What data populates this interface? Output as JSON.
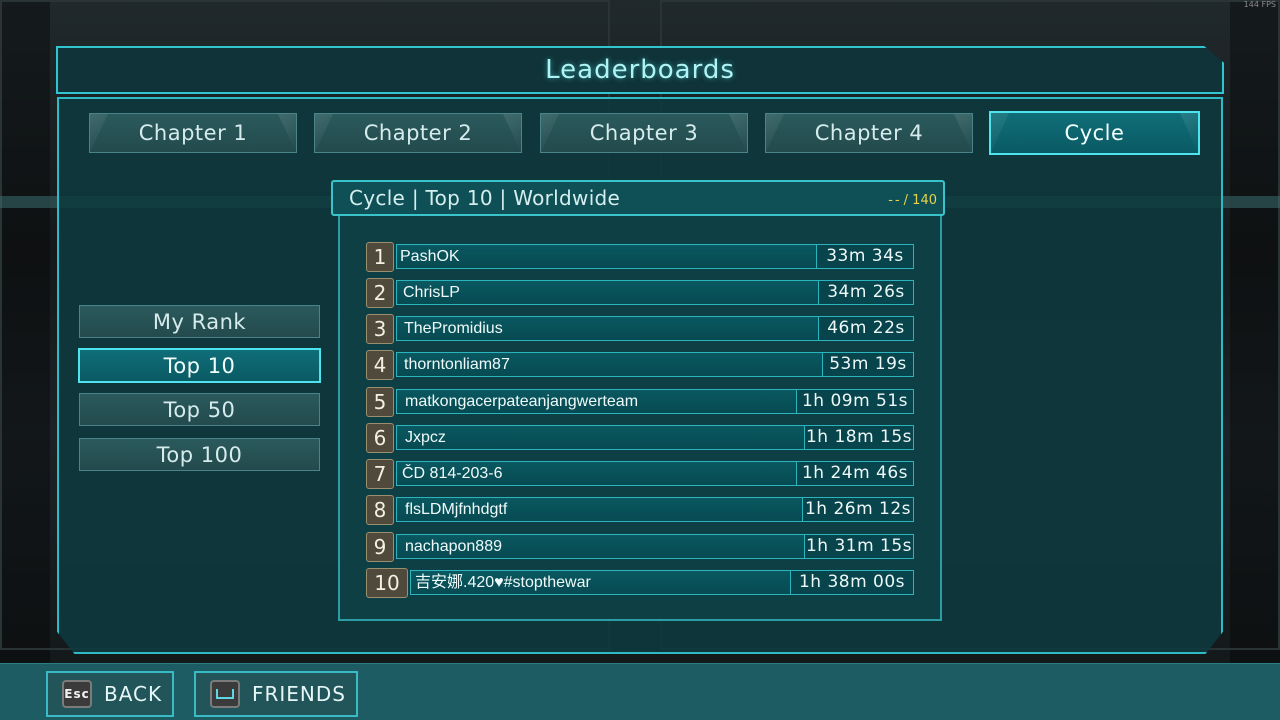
{
  "fps": "144 FPS",
  "title": "Leaderboards",
  "tabs": [
    {
      "label": "Chapter 1",
      "active": false
    },
    {
      "label": "Chapter 2",
      "active": false
    },
    {
      "label": "Chapter 3",
      "active": false
    },
    {
      "label": "Chapter 4",
      "active": false
    },
    {
      "label": "Cycle",
      "active": true
    }
  ],
  "filters": [
    {
      "label": "My Rank",
      "active": false
    },
    {
      "label": "Top 10",
      "active": true
    },
    {
      "label": "Top 50",
      "active": false
    },
    {
      "label": "Top 100",
      "active": false
    }
  ],
  "leaderboard": {
    "title": "Cycle | Top 10 | Worldwide",
    "my_rank": "--",
    "total": "/ 140",
    "entries": [
      {
        "rank": "1",
        "name": "PashOK",
        "time": "33m 34s"
      },
      {
        "rank": "2",
        "name": "ChrisLP",
        "time": "34m 26s"
      },
      {
        "rank": "3",
        "name": "ThePromidius",
        "time": "46m 22s"
      },
      {
        "rank": "4",
        "name": "thorntonliam87",
        "time": "53m 19s"
      },
      {
        "rank": "5",
        "name": "matkongacerpateanjangwerteam",
        "time": "1h 09m 51s"
      },
      {
        "rank": "6",
        "name": "Jxpcz",
        "time": "1h 18m 15s"
      },
      {
        "rank": "7",
        "name": "ČD 814-203-6",
        "time": "1h 24m 46s"
      },
      {
        "rank": "8",
        "name": "flsLDMjfnhdgtf",
        "time": "1h 26m 12s"
      },
      {
        "rank": "9",
        "name": "nachapon889",
        "time": "1h 31m 15s"
      },
      {
        "rank": "10",
        "name": "吉安娜.420♥#stopthewar",
        "time": "1h 38m 00s"
      }
    ]
  },
  "bottom": {
    "back": {
      "key": "Esc",
      "label": "BACK"
    },
    "friends": {
      "key_icon": "spacebar-icon",
      "label": "FRIENDS"
    }
  },
  "colors": {
    "accent": "#2fc6d2",
    "active_tab": "#0f6e78",
    "count_text": "#e7d34a"
  }
}
